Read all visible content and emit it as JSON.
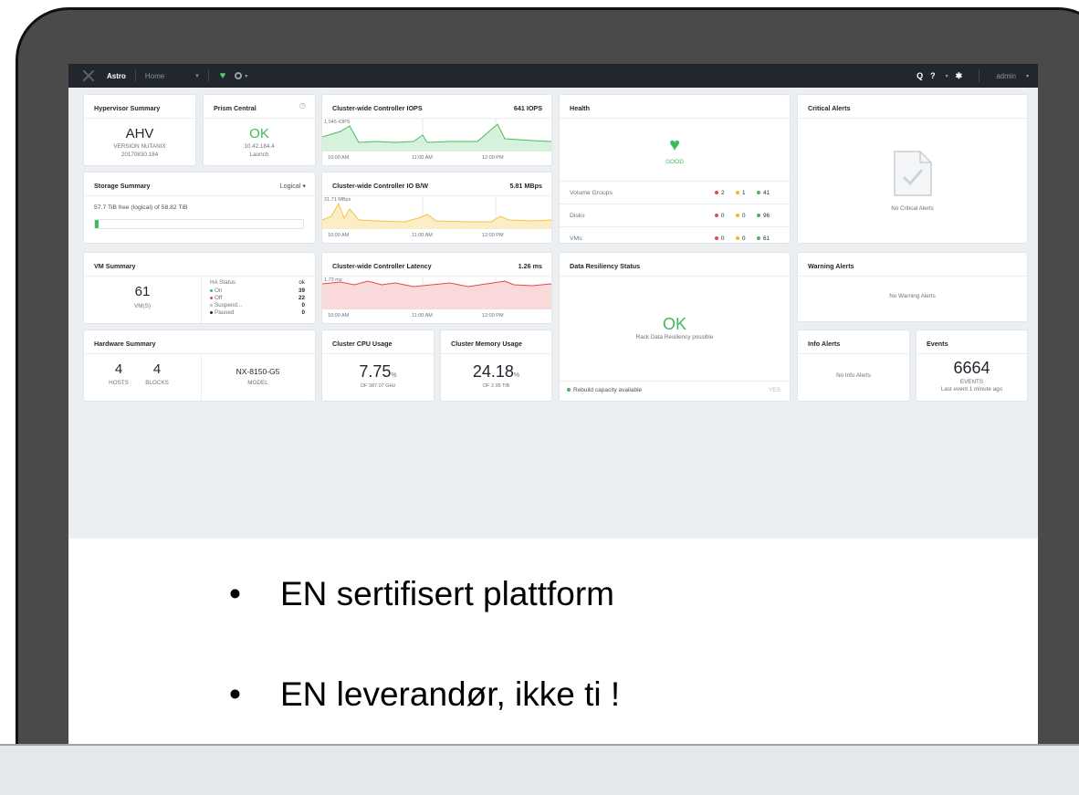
{
  "topbar": {
    "cluster": "Astro",
    "nav": "Home",
    "user": "admin",
    "icons": [
      "nutanix-logo",
      "heart-health-icon",
      "ring-status-icon",
      "search-icon",
      "help-icon",
      "gear-icon"
    ],
    "help_symbol": "?",
    "search_symbol": "Q"
  },
  "widgets": {
    "hypervisor": {
      "title": "Hypervisor Summary",
      "name": "AHV",
      "line1": "VERSION NUTANIX",
      "line2": "20170830.184"
    },
    "prism": {
      "title": "Prism Central",
      "status": "OK",
      "ip": "10.42.184.4",
      "launch": "Launch"
    },
    "iops": {
      "title": "Cluster-wide Controller IOPS",
      "value": "641 IOPS",
      "peak": "1,045 IOPS",
      "times": [
        "10:00 AM",
        "11:00 AM",
        "12:00 PM"
      ],
      "color": "#4dbb5f"
    },
    "health": {
      "title": "Health",
      "status": "GOOD",
      "rows": [
        {
          "name": "Volume Groups",
          "red": "2",
          "amber": "1",
          "green": "41"
        },
        {
          "name": "Disks",
          "red": "0",
          "amber": "0",
          "green": "96"
        },
        {
          "name": "VMs",
          "red": "0",
          "amber": "0",
          "green": "61"
        }
      ]
    },
    "critical": {
      "title": "Critical Alerts",
      "empty": "No Critical Alerts"
    },
    "storage": {
      "title": "Storage Summary",
      "mode": "Logical",
      "text": "57.7 TiB free (logical) of 58.82 TiB",
      "used_fraction": 0.019
    },
    "iobw": {
      "title": "Cluster-wide Controller IO B/W",
      "value": "5.81 MBps",
      "peak": "21.71 MBps",
      "times": [
        "10:00 AM",
        "11:00 AM",
        "12:00 PM"
      ],
      "color": "#f5c242"
    },
    "vmsummary": {
      "title": "VM Summary",
      "count": "61",
      "unit": "VM(S)",
      "ha_label": "HA Status",
      "ha_value": "ok",
      "states": [
        {
          "label": "On",
          "value": "39",
          "color": "#3dbb5e"
        },
        {
          "label": "Off",
          "value": "22",
          "color": "#e5484d"
        },
        {
          "label": "Suspend...",
          "value": "0",
          "color": "#b9bfc6"
        },
        {
          "label": "Paused",
          "value": "0",
          "color": "#22272e"
        }
      ]
    },
    "latency": {
      "title": "Cluster-wide Controller Latency",
      "value": "1.26 ms",
      "peak": "1.73 ms",
      "times": [
        "10:00 AM",
        "11:00 AM",
        "12:00 PM"
      ],
      "color": "#e5484d"
    },
    "resiliency": {
      "title": "Data Resiliency Status",
      "status": "OK",
      "desc": "Rack Data Resiliency possible",
      "rebuild": "Rebuild capacity available",
      "rebuild_value": "YES"
    },
    "warning": {
      "title": "Warning Alerts",
      "empty": "No Warning Alerts"
    },
    "hardware": {
      "title": "Hardware Summary",
      "hosts": "4",
      "hosts_label": "HOSTS",
      "blocks": "4",
      "blocks_label": "BLOCKS",
      "model": "NX-8150-G5",
      "model_label": "MODEL"
    },
    "cpu": {
      "title": "Cluster CPU Usage",
      "value": "7.75",
      "unit": "%",
      "of": "OF 387.07 GHz"
    },
    "memory": {
      "title": "Cluster Memory Usage",
      "value": "24.18",
      "unit": "%",
      "of": "OF 2.95 TiB"
    },
    "info": {
      "title": "Info Alerts",
      "empty": "No Info Alerts"
    },
    "events": {
      "title": "Events",
      "count": "6664",
      "label": "EVENTS",
      "last": "Last event 1 minute ago"
    }
  },
  "bullets": [
    {
      "mark": "•",
      "text": "EN sertifisert plattform"
    },
    {
      "mark": "•",
      "text": "EN leverandør, ikke ti !"
    }
  ]
}
